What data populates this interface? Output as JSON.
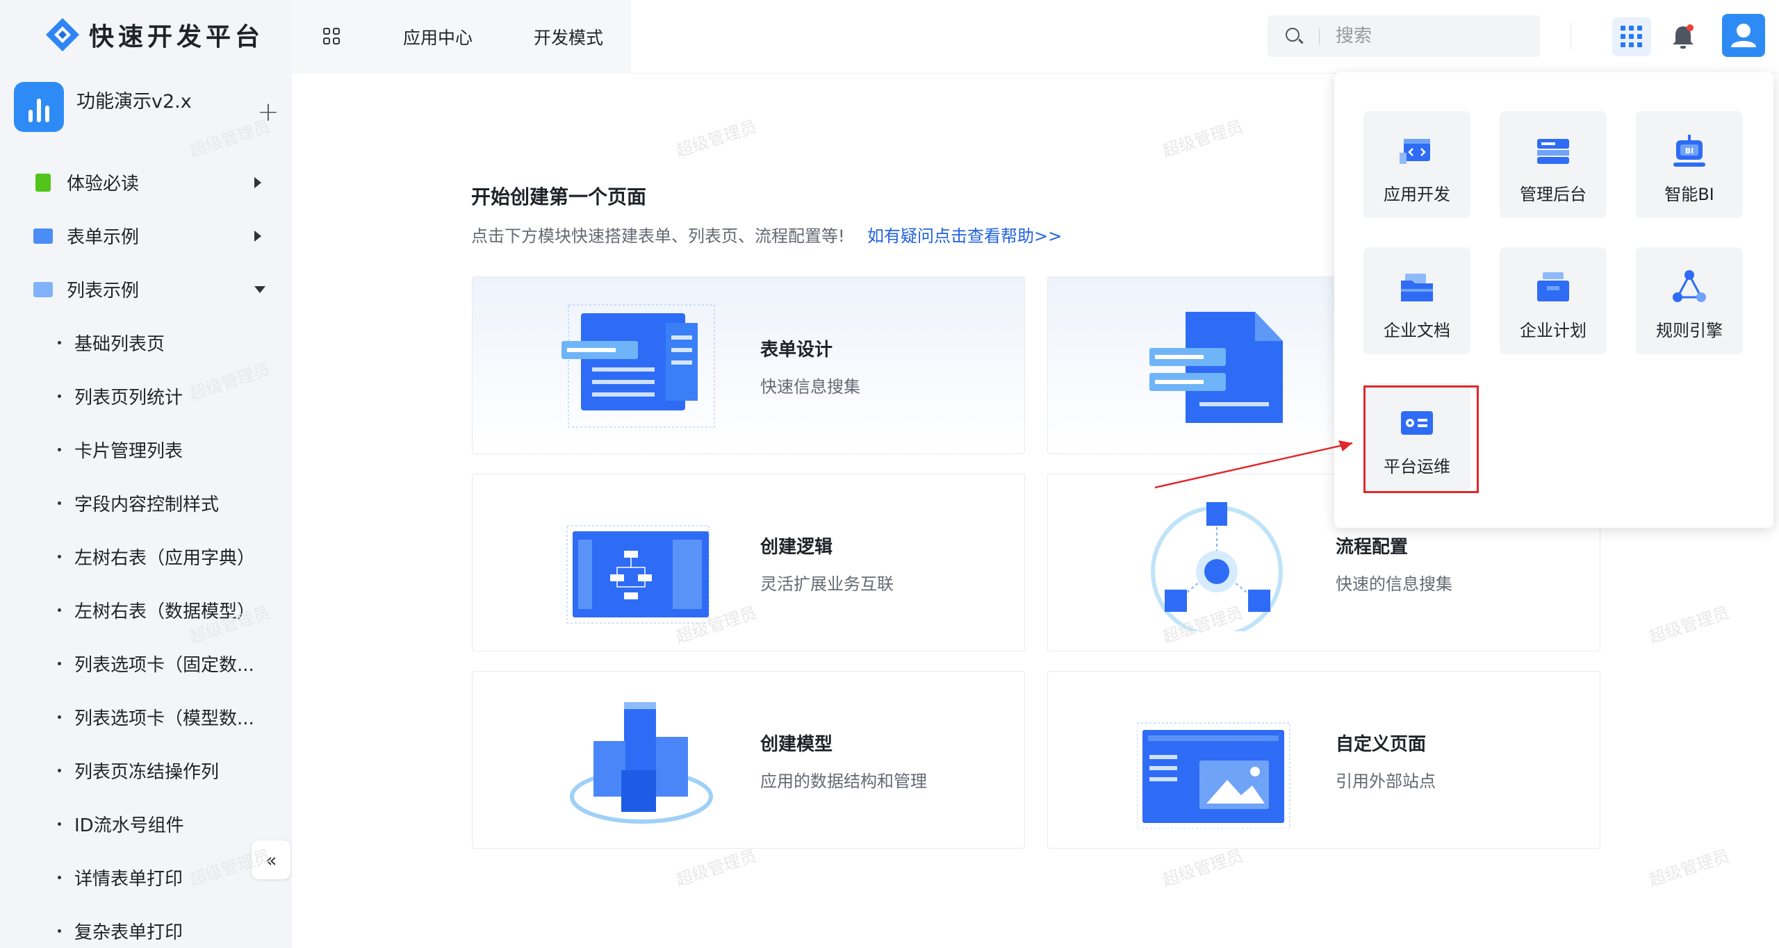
{
  "brand": {
    "name": "快速开发平台"
  },
  "app": {
    "name": "功能演示v2.x",
    "add_label": "+"
  },
  "sidebar": {
    "items": [
      {
        "label": "体验必读",
        "icon": "book-icon",
        "color": "#52c41a"
      },
      {
        "label": "表单示例",
        "icon": "folder-icon",
        "color": "#3b82f6"
      },
      {
        "label": "列表示例",
        "icon": "folder-open-icon",
        "color": "#6ea8f7"
      }
    ],
    "sub_items": [
      "基础列表页",
      "列表页列统计",
      "卡片管理列表",
      "字段内容控制样式",
      "左树右表（应用字典）",
      "左树右表（数据模型）",
      "列表选项卡（固定数...",
      "列表选项卡（模型数...",
      "列表页冻结操作列",
      "ID流水号组件",
      "详情表单打印",
      "复杂表单打印"
    ],
    "collapse_label": "«"
  },
  "header": {
    "nav": [
      "应用中心",
      "开发模式"
    ],
    "search_placeholder": "搜索"
  },
  "main": {
    "title": "开始创建第一个页面",
    "subtitle": "点击下方模块快速搭建表单、列表页、流程配置等!",
    "help_link": "如有疑问点击查看帮助>>",
    "cards": [
      {
        "title": "表单设计",
        "desc": "快速信息搜集"
      },
      {
        "title": "",
        "desc": ""
      },
      {
        "title": "创建逻辑",
        "desc": "灵活扩展业务互联"
      },
      {
        "title": "流程配置",
        "desc": "快速的信息搜集"
      },
      {
        "title": "创建模型",
        "desc": "应用的数据结构和管理"
      },
      {
        "title": "自定义页面",
        "desc": "引用外部站点"
      }
    ]
  },
  "dropdown": {
    "tiles": [
      {
        "label": "应用开发",
        "icon": "code-window-icon"
      },
      {
        "label": "管理后台",
        "icon": "server-icon"
      },
      {
        "label": "智能BI",
        "icon": "bi-robot-icon"
      },
      {
        "label": "企业文档",
        "icon": "folder-doc-icon"
      },
      {
        "label": "企业计划",
        "icon": "inbox-icon"
      },
      {
        "label": "规则引擎",
        "icon": "nodes-icon"
      },
      {
        "label": "平台运维",
        "icon": "settings-panel-icon"
      }
    ]
  },
  "watermark": "超级管理员",
  "colors": {
    "accent": "#2e6cf6",
    "highlight": "#e0282b",
    "link": "#2061e0"
  }
}
